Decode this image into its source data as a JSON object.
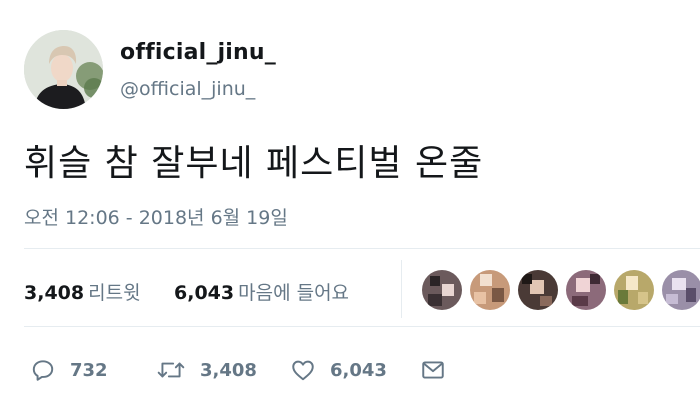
{
  "user": {
    "display_name": "official_jinu_",
    "handle": "@official_jinu_",
    "avatar_icon": "profile-photo"
  },
  "tweet": {
    "text": "휘슬 참 잘부네 페스티벌 온줄",
    "timestamp": "오전 12:06 - 2018년 6월 19일"
  },
  "stats": {
    "retweets_count": "3,408",
    "retweets_label": "리트윗",
    "likes_count": "6,043",
    "likes_label": "마음에 들어요"
  },
  "likers": [
    {
      "icon": "user-avatar",
      "color": "#6b5a5c"
    },
    {
      "icon": "user-avatar",
      "color": "#c79a7a"
    },
    {
      "icon": "user-avatar",
      "color": "#4a3a36"
    },
    {
      "icon": "user-avatar",
      "color": "#8c6a7a"
    },
    {
      "icon": "user-avatar",
      "color": "#b8a86a"
    },
    {
      "icon": "user-avatar",
      "color": "#9a8fa8"
    }
  ],
  "actions": {
    "reply_count": "732",
    "retweet_count": "3,408",
    "like_count": "6,043"
  },
  "colors": {
    "text_primary": "#14171a",
    "text_secondary": "#657786",
    "divider": "#e6ecf0"
  }
}
